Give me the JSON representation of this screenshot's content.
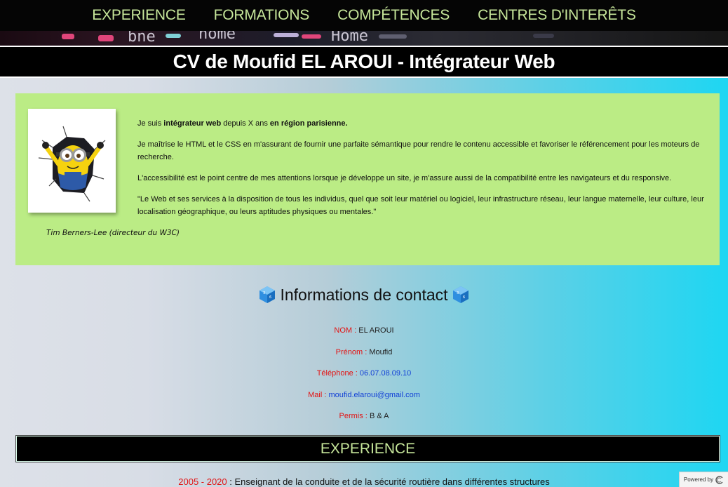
{
  "nav": {
    "items": [
      {
        "label": "EXPERIENCE"
      },
      {
        "label": "FORMATIONS"
      },
      {
        "label": "COMPÉTENCES"
      },
      {
        "label": "CENTRES D'INTERÊTS"
      }
    ]
  },
  "banner": {
    "fragments": [
      "bne",
      "home",
      "Home"
    ]
  },
  "header": {
    "title": "CV de Moufid EL AROUI - Intégrateur Web"
  },
  "intro": {
    "p1_prefix": "Je suis ",
    "p1_bold1": "intégrateur web",
    "p1_mid": " depuis X ans ",
    "p1_bold2": "en région parisienne.",
    "p2": "Je maîtrise le HTML et le CSS en m'assurant de fournir une parfaite sémantique pour rendre le contenu accessible et favoriser le référencement pour les moteurs de recherche.",
    "p3": "L'accessibilité est le point centre de mes attentions lorsque je développe un site, je m'assure aussi de la compatibilité entre les navigateurs et du responsive.",
    "quote": "\"Le Web et ses services à la disposition de tous les individus, quel que soit leur matériel ou logiciel, leur infrastructure réseau, leur langue maternelle, leur culture, leur localisation géographique, ou leurs aptitudes physiques ou mentales.\"",
    "quote_author": "Tim Berners-Lee (directeur du W3C)"
  },
  "contact": {
    "title": "Informations de contact",
    "rows": [
      {
        "label": "NOM :",
        "value": "EL AROUI"
      },
      {
        "label": "Prénom :",
        "value": "Moufid"
      },
      {
        "label": "Téléphone :",
        "value": "06.07.08.09.10"
      },
      {
        "label": "Mail :",
        "value": "moufid.elaroui@gmail.com"
      },
      {
        "label": "Permis :",
        "value": "B & A"
      }
    ]
  },
  "experience": {
    "title": "EXPERIENCE",
    "first_years": "2005 - 2020",
    "first_desc": " : Enseignant de la conduite et de la sécurité routière dans différentes structures"
  },
  "footer": {
    "powered_by": "Powered by"
  },
  "colors": {
    "nav_text": "#c6e69a",
    "intro_bg": "#bbec85",
    "label_red": "#e31212",
    "link_blue": "#1240d6"
  }
}
